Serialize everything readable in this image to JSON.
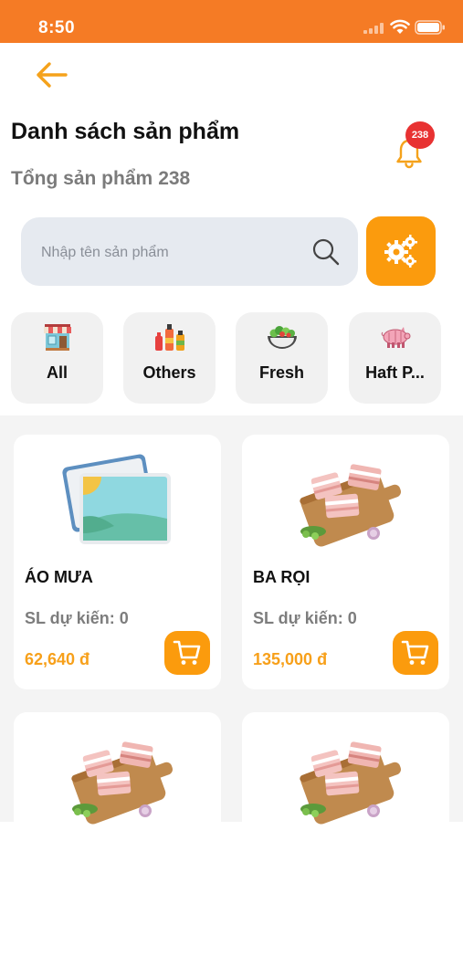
{
  "status_bar": {
    "time": "8:50"
  },
  "header": {
    "title": "Danh sách sản phẩm",
    "total_label": "Tổng sản phẩm",
    "total_count": "238",
    "notification_count": "238"
  },
  "search": {
    "placeholder": "Nhập tên sản phẩm",
    "value": ""
  },
  "categories": [
    {
      "label": "All",
      "icon": "store-icon"
    },
    {
      "label": "Others",
      "icon": "bottles-icon"
    },
    {
      "label": "Fresh",
      "icon": "salad-bowl-icon"
    },
    {
      "label": "Haft P...",
      "icon": "pig-icon"
    }
  ],
  "products": [
    {
      "name": "ÁO MƯA",
      "qty_label": "SL dự kiến: 0",
      "price": "62,640 đ",
      "image": "placeholder-image-icon"
    },
    {
      "name": "BA RỌI",
      "qty_label": "SL dự kiến: 0",
      "price": "135,000 đ",
      "image": "pork-belly-image"
    },
    {
      "name": "",
      "qty_label": "",
      "price": "",
      "image": "pork-belly-image"
    },
    {
      "name": "",
      "qty_label": "",
      "price": "",
      "image": "pork-belly-image"
    }
  ],
  "colors": {
    "brand_orange": "#f57b25",
    "accent_orange": "#fb9b0d",
    "price_orange": "#f7a01a",
    "badge_red": "#e83232"
  }
}
